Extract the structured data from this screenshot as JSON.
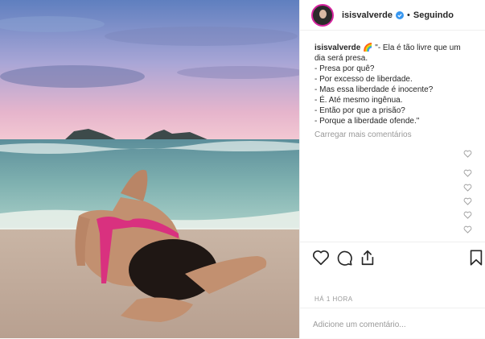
{
  "post": {
    "username": "isisvalverde",
    "follow_label": "Seguindo",
    "separator": "•",
    "caption_user": "isisvalverde",
    "caption_first": "🌈 \"- Ela é tão livre que um",
    "caption_lines": [
      "dia será presa.",
      "- Presa por quê?",
      "- Por excesso de liberdade.",
      "- Mas essa liberdade é inocente?",
      "- É. Até mesmo ingênua.",
      "- Então por que a prisão?",
      "- Porque a liberdade ofende.\""
    ],
    "load_more": "Carregar mais comentários",
    "timestamp": "HÁ 1 HORA",
    "comment_placeholder": "Adicione um comentário..."
  },
  "icons": {
    "like": "heart-icon",
    "comment": "comment-icon",
    "share": "share-icon",
    "save": "bookmark-icon",
    "verified": "verified-badge-icon"
  },
  "colors": {
    "verified": "#3897f0",
    "text": "#262626",
    "muted": "#999999",
    "border": "#efefef",
    "story_ring": "#d6249f"
  }
}
